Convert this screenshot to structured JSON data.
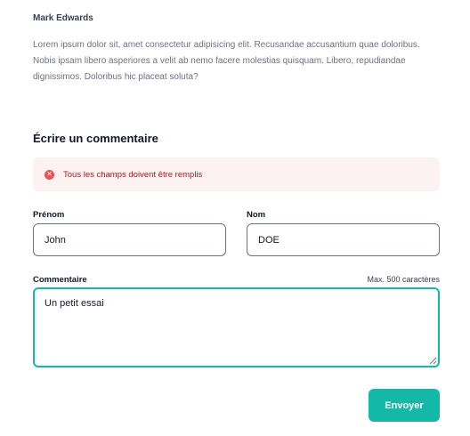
{
  "comment": {
    "author": "Mark Edwards",
    "body": "Lorem ipsum dolor sit, amet consectetur adipisicing elit. Recusandae accusantium quae doloribus. Nobis ipsam libero asperiores a velit ab nemo facere molestias quisquam. Libero, repudiandae dignissimos. Doloribus hic placeat soluta?"
  },
  "form": {
    "title": "Écrire un commentaire",
    "alert": {
      "icon": "x-circle-icon",
      "text": "Tous les champs doivent être remplis"
    },
    "firstname": {
      "label": "Prénom",
      "value": "John"
    },
    "lastname": {
      "label": "Nom",
      "value": "DOE"
    },
    "comment_field": {
      "label": "Commentaire",
      "hint": "Max. 500 caractères",
      "value": "Un petit essai"
    },
    "submit_label": "Envoyer"
  },
  "colors": {
    "accent": "#14b8a6",
    "alert_bg": "#fdf2f2",
    "alert_text": "#9b1c1c",
    "alert_icon": "#f05252"
  }
}
